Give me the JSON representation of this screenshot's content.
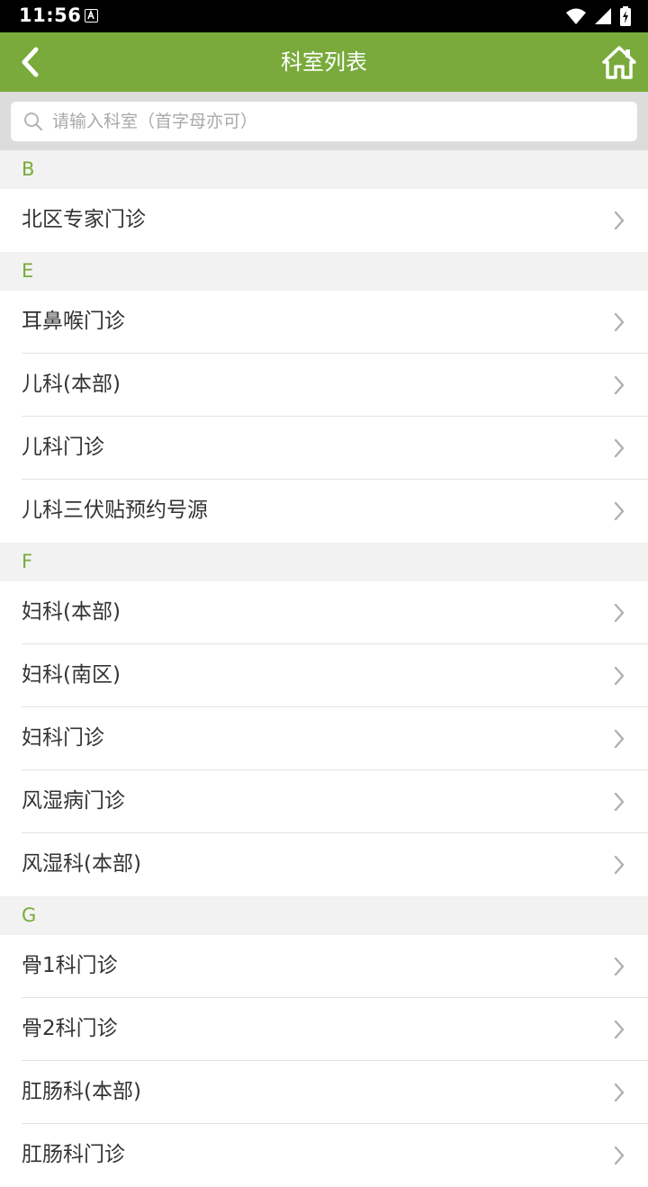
{
  "status_bar": {
    "time": "11:56"
  },
  "app_bar": {
    "title": "科室列表"
  },
  "search": {
    "placeholder": "请输入科室（首字母亦可）",
    "value": ""
  },
  "sections": [
    {
      "letter": "B",
      "items": [
        "北区专家门诊"
      ]
    },
    {
      "letter": "E",
      "items": [
        "耳鼻喉门诊",
        "儿科(本部)",
        "儿科门诊",
        "儿科三伏贴预约号源"
      ]
    },
    {
      "letter": "F",
      "items": [
        "妇科(本部)",
        "妇科(南区)",
        "妇科门诊",
        "风湿病门诊",
        "风湿科(本部)"
      ]
    },
    {
      "letter": "G",
      "items": [
        "骨1科门诊",
        "骨2科门诊",
        "肛肠科(本部)",
        "肛肠科门诊"
      ]
    }
  ],
  "colors": {
    "accent": "#79aa3b",
    "section_bg": "#f2f2f2",
    "search_bg": "#dcdcdc"
  },
  "icons": {
    "back": "back-arrow-icon",
    "home": "home-icon",
    "search": "search-icon",
    "chevron": "chevron-right-icon"
  }
}
